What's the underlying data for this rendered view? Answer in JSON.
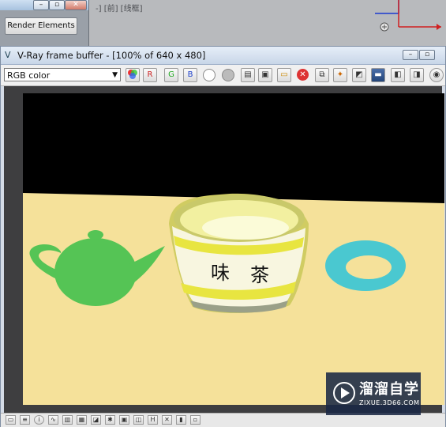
{
  "top_panel": {
    "render_elements_label": "Render Elements",
    "minimize_glyph": "–",
    "restore_glyph": "▫",
    "close_glyph": "✕"
  },
  "viewport": {
    "label": "-] [前] [线框]",
    "axis_x_color": "#d02020",
    "axis_y_color": "#1a3ad0"
  },
  "vfb": {
    "title": "V-Ray frame buffer - [100% of 640 x 480]",
    "icon": "vray-icon",
    "channel": "RGB color",
    "toolbar_icons": [
      "rgb-channel-icon",
      "red-channel-icon",
      "green-channel-icon",
      "blue-channel-icon",
      "white-circle-icon",
      "gray-circle-icon",
      "save-icon",
      "save-all-icon",
      "open-icon",
      "clear-icon",
      "copy-icon",
      "track-mouse-icon",
      "render-region-icon",
      "link-icon",
      "display-correction-icon",
      "history-icon",
      "stop-icon",
      "render-icon"
    ],
    "statusbar_icons": [
      "color-corrections-icon",
      "levels-icon",
      "info-icon",
      "curves-icon",
      "exposure-icon",
      "histogram-icon",
      "lut-icon",
      "ocio-icon",
      "icc-icon",
      "srgb-icon",
      "pixel-aspect-icon",
      "stereo-icon",
      "lens-effects-icon"
    ]
  },
  "scene": {
    "floor_color": "#f5e19a",
    "background_color": "#000000",
    "teapot_color": "#55c455",
    "torus_color": "#4ac8d0",
    "cup_text": "味茶",
    "cup_text_left": "味",
    "cup_text_right": "茶"
  },
  "watermark": {
    "name": "溜溜自学",
    "url": "ZIXUE.3D66.COM"
  }
}
